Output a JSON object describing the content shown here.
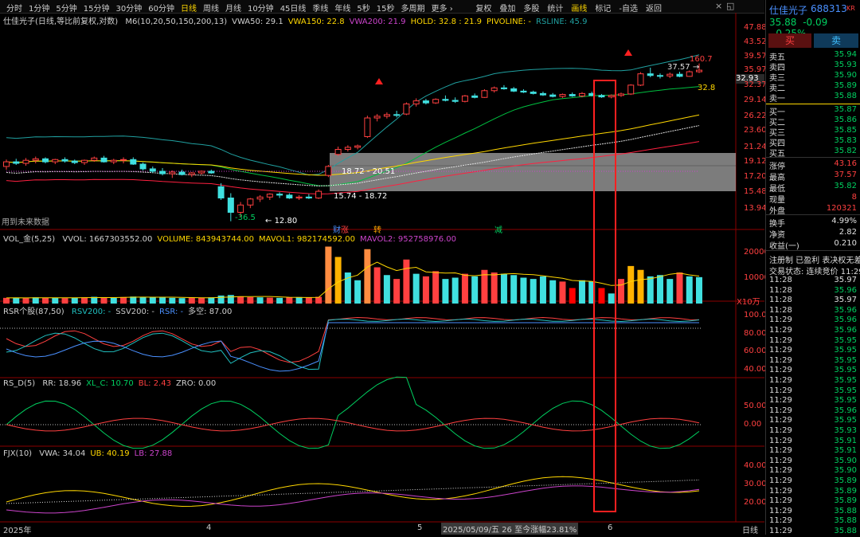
{
  "toolbar": {
    "periods": [
      "分时",
      "1分钟",
      "5分钟",
      "15分钟",
      "30分钟",
      "60分钟",
      "日线",
      "周线",
      "月线",
      "10分钟",
      "45日线",
      "季线",
      "年线",
      "5秒",
      "15秒",
      "多周期",
      "更多 ›"
    ],
    "active_period": "日线",
    "tools": [
      "复权",
      "叠加",
      "多股",
      "统计",
      "画线",
      "标记",
      "-自选",
      "返回"
    ],
    "highlight_tool": "画线",
    "window_controls": [
      "×",
      "◱"
    ]
  },
  "main_panel": {
    "title": "仕佳光子(日线,等比前复权,对数)",
    "indicators": [
      {
        "text": "M6(10,20,50,150,200,13)",
        "color": "#d0d0d0"
      },
      {
        "text": "VWA50: 29.1",
        "color": "#d0d0d0"
      },
      {
        "text": "VWA150: 22.8",
        "color": "#ffd700"
      },
      {
        "text": "VWA200: 21.9",
        "color": "#cc44cc"
      },
      {
        "text": "HOLD: 32.8 : 21.9",
        "color": "#ffd700"
      },
      {
        "text": "PIVOLINE: -",
        "color": "#ffd700"
      },
      {
        "text": "RSLINE: 45.9",
        "color": "#20a0a0"
      }
    ],
    "y_ticks": [
      "47.88",
      "43.52",
      "39.57",
      "35.97",
      "32.37",
      "29.14",
      "26.22",
      "23.60",
      "21.24",
      "19.12",
      "17.20",
      "15.48",
      "13.94"
    ],
    "current_price_tag": "32.93",
    "annotations": {
      "high_label": "160.7",
      "high_price": "37.57",
      "hold_label": "32.8",
      "zone_upper": "18.72 - 20.51",
      "zone_lower": "15.74 - 18.72",
      "low_price": "12.80",
      "low_pct": "-36.5",
      "future_note": "用到未来数据"
    }
  },
  "volume_panel": {
    "title": "VOL_金(5,25)",
    "values": [
      {
        "text": "VVOL: 1667303552.00",
        "color": "#d0d0d0"
      },
      {
        "text": "VOLUME: 843943744.00",
        "color": "#ffd700"
      },
      {
        "text": "MAVOL1: 982174592.00",
        "color": "#ffd700"
      },
      {
        "text": "MAVOL2: 952758976.00",
        "color": "#cc44cc"
      }
    ],
    "y_ticks": [
      "20000",
      "10000"
    ],
    "unit": "X10万",
    "event_tags": [
      {
        "text": "财",
        "color": "#4a90ff"
      },
      {
        "text": "涨",
        "color": "#ff4040"
      },
      {
        "text": "转",
        "color": "#ffa500"
      },
      {
        "text": "减",
        "color": "#00d060"
      }
    ]
  },
  "rsr_panel": {
    "title": "RSR个股(87,50)",
    "values": [
      {
        "text": "RSV200: -",
        "color": "#20c0c0"
      },
      {
        "text": "SSV200: -",
        "color": "#c8c8c8"
      },
      {
        "text": "RSR: -",
        "color": "#4a90ff"
      },
      {
        "text": "多空: 87.00",
        "color": "#d0d0d0"
      }
    ],
    "y_ticks": [
      "100.0",
      "80.00",
      "60.00",
      "40.00"
    ]
  },
  "rsd_panel": {
    "title": "RS_D(5)",
    "values": [
      {
        "text": "RR: 18.96",
        "color": "#d0d0d0"
      },
      {
        "text": "XL_C: 10.70",
        "color": "#00d060"
      },
      {
        "text": "BL: 2.43",
        "color": "#ff4040"
      },
      {
        "text": "ZRO: 0.00",
        "color": "#d0d0d0"
      }
    ],
    "y_ticks": [
      "50.00",
      "0.00"
    ]
  },
  "fjx_panel": {
    "title": "FJX(10)",
    "values": [
      {
        "text": "VWA: 34.04",
        "color": "#d0d0d0"
      },
      {
        "text": "UB: 40.19",
        "color": "#ffd700"
      },
      {
        "text": "LB: 27.88",
        "color": "#cc44cc"
      }
    ],
    "y_ticks": [
      "40.00",
      "30.00",
      "20.00"
    ]
  },
  "time_axis": {
    "labels": [
      "2025年",
      "4",
      "5",
      "6"
    ],
    "status": "2025/05/09/五 26 至今涨幅23.81%",
    "mode": "日线"
  },
  "quote": {
    "name": "仕佳光子",
    "code": "688313",
    "market": "KR",
    "price": "35.88",
    "change": "-0.09",
    "change_pct": "-0.25%",
    "buy_label": "买",
    "sell_label": "卖",
    "asks": [
      {
        "label": "卖五",
        "price": "35.94"
      },
      {
        "label": "卖四",
        "price": "35.93"
      },
      {
        "label": "卖三",
        "price": "35.90"
      },
      {
        "label": "卖二",
        "price": "35.89"
      },
      {
        "label": "卖一",
        "price": "35.88"
      }
    ],
    "bids": [
      {
        "label": "买一",
        "price": "35.87"
      },
      {
        "label": "买二",
        "price": "35.86"
      },
      {
        "label": "买三",
        "price": "35.85"
      },
      {
        "label": "买四",
        "price": "35.83"
      },
      {
        "label": "买五",
        "price": "35.82"
      }
    ],
    "stats": [
      {
        "label": "涨停",
        "value": "43.16",
        "color": "#ff4040"
      },
      {
        "label": "最高",
        "value": "37.57",
        "color": "#ff4040"
      },
      {
        "label": "最低",
        "value": "35.82",
        "color": "#00d060"
      },
      {
        "label": "现量",
        "value": "8",
        "color": "#ff4040"
      },
      {
        "label": "外盘",
        "value": "120321",
        "color": "#ff4040"
      }
    ],
    "stats2": [
      {
        "label": "换手",
        "value": "4.99%"
      },
      {
        "label": "净资",
        "value": "2.82"
      },
      {
        "label": "收益(一)",
        "value": "0.210"
      }
    ],
    "info1": "注册制 已盈利 表决权无差",
    "info2": "交易状态: 连续竞价 11:29",
    "ticks": [
      {
        "time": "11:28",
        "price": "35.97",
        "color": "#e0e0e0"
      },
      {
        "time": "11:28",
        "price": "35.96",
        "color": "#00d060"
      },
      {
        "time": "11:28",
        "price": "35.97",
        "color": "#e0e0e0"
      },
      {
        "time": "11:28",
        "price": "35.96",
        "color": "#00d060"
      },
      {
        "time": "11:29",
        "price": "35.96",
        "color": "#00d060"
      },
      {
        "time": "11:29",
        "price": "35.96",
        "color": "#00d060"
      },
      {
        "time": "11:29",
        "price": "35.95",
        "color": "#00d060"
      },
      {
        "time": "11:29",
        "price": "35.95",
        "color": "#00d060"
      },
      {
        "time": "11:29",
        "price": "35.95",
        "color": "#00d060"
      },
      {
        "time": "11:29",
        "price": "35.95",
        "color": "#00d060"
      },
      {
        "time": "11:29",
        "price": "35.95",
        "color": "#00d060"
      },
      {
        "time": "11:29",
        "price": "35.95",
        "color": "#00d060"
      },
      {
        "time": "11:29",
        "price": "35.95",
        "color": "#00d060"
      },
      {
        "time": "11:29",
        "price": "35.96",
        "color": "#00d060"
      },
      {
        "time": "11:29",
        "price": "35.95",
        "color": "#00d060"
      },
      {
        "time": "11:29",
        "price": "35.93",
        "color": "#00d060"
      },
      {
        "time": "11:29",
        "price": "35.91",
        "color": "#00d060"
      },
      {
        "time": "11:29",
        "price": "35.91",
        "color": "#00d060"
      },
      {
        "time": "11:29",
        "price": "35.90",
        "color": "#00d060"
      },
      {
        "time": "11:29",
        "price": "35.90",
        "color": "#00d060"
      },
      {
        "time": "11:29",
        "price": "35.89",
        "color": "#00d060"
      },
      {
        "time": "11:29",
        "price": "35.89",
        "color": "#00d060"
      },
      {
        "time": "11:29",
        "price": "35.89",
        "color": "#00d060"
      },
      {
        "time": "11:29",
        "price": "35.88",
        "color": "#00d060"
      },
      {
        "time": "11:29",
        "price": "35.88",
        "color": "#00d060"
      },
      {
        "time": "11:29",
        "price": "35.88",
        "color": "#00d060"
      }
    ]
  },
  "colors": {
    "up": "#ff4040",
    "down": "#40e0e0",
    "volume_up": "#ff4040",
    "volume_down": "#40e0e0",
    "highlight_box": "#ff2020"
  },
  "chart_data": {
    "type": "candlestick",
    "scale": "log",
    "ylim": [
      13.94,
      47.88
    ],
    "candles": [
      [
        18.6,
        19.5,
        18.2,
        19.2
      ],
      [
        19.2,
        19.6,
        18.8,
        19.0
      ],
      [
        19.0,
        19.7,
        18.7,
        19.4
      ],
      [
        19.4,
        19.9,
        19.0,
        19.6
      ],
      [
        19.6,
        19.8,
        19.0,
        19.2
      ],
      [
        19.2,
        19.6,
        18.9,
        19.5
      ],
      [
        19.5,
        19.8,
        19.1,
        19.3
      ],
      [
        19.3,
        19.5,
        18.9,
        19.1
      ],
      [
        19.1,
        19.5,
        18.8,
        19.4
      ],
      [
        19.4,
        19.9,
        19.2,
        19.7
      ],
      [
        19.7,
        20.0,
        19.1,
        19.2
      ],
      [
        19.2,
        19.6,
        18.9,
        19.4
      ],
      [
        19.4,
        19.8,
        19.0,
        19.5
      ],
      [
        19.5,
        19.8,
        18.8,
        18.9
      ],
      [
        18.9,
        19.1,
        18.1,
        18.3
      ],
      [
        18.3,
        18.6,
        17.8,
        18.0
      ],
      [
        18.0,
        18.4,
        17.5,
        17.7
      ],
      [
        17.7,
        18.1,
        17.2,
        17.9
      ],
      [
        17.9,
        18.2,
        17.5,
        17.6
      ],
      [
        17.6,
        17.9,
        17.3,
        17.8
      ],
      [
        17.8,
        18.1,
        17.6,
        18.0
      ],
      [
        18.0,
        18.2,
        17.7,
        17.8
      ],
      [
        16.2,
        16.6,
        14.8,
        15.0
      ],
      [
        15.0,
        15.5,
        12.8,
        13.6
      ],
      [
        13.6,
        14.6,
        13.2,
        14.3
      ],
      [
        14.3,
        15.0,
        14.0,
        14.9
      ],
      [
        14.9,
        15.3,
        14.6,
        15.1
      ],
      [
        15.1,
        15.5,
        14.8,
        15.4
      ],
      [
        15.4,
        15.6,
        15.0,
        15.3
      ],
      [
        15.3,
        15.5,
        14.9,
        15.0
      ],
      [
        15.0,
        15.3,
        14.8,
        15.1
      ],
      [
        15.1,
        15.4,
        14.9,
        15.0
      ],
      [
        15.0,
        15.9,
        14.9,
        15.7
      ],
      [
        17.5,
        18.8,
        17.3,
        18.6
      ],
      [
        20.2,
        21.3,
        20.0,
        20.9
      ],
      [
        20.9,
        21.5,
        20.6,
        21.2
      ],
      [
        21.2,
        21.6,
        20.9,
        21.4
      ],
      [
        22.8,
        26.3,
        22.6,
        25.9
      ],
      [
        25.9,
        26.6,
        25.3,
        26.2
      ],
      [
        26.2,
        26.9,
        25.8,
        26.5
      ],
      [
        26.5,
        27.2,
        26.0,
        26.4
      ],
      [
        26.6,
        28.8,
        26.4,
        28.5
      ],
      [
        28.5,
        29.6,
        28.0,
        29.1
      ],
      [
        29.1,
        29.5,
        28.4,
        28.7
      ],
      [
        28.7,
        29.6,
        28.5,
        29.4
      ],
      [
        29.4,
        30.2,
        29.0,
        29.2
      ],
      [
        29.2,
        29.8,
        28.7,
        29.0
      ],
      [
        29.0,
        30.3,
        28.8,
        30.1
      ],
      [
        30.1,
        30.6,
        29.6,
        29.8
      ],
      [
        29.8,
        31.5,
        29.7,
        31.2
      ],
      [
        31.2,
        32.1,
        30.8,
        31.8
      ],
      [
        31.8,
        32.4,
        31.4,
        31.6
      ],
      [
        31.6,
        32.0,
        30.9,
        31.1
      ],
      [
        31.1,
        31.5,
        30.7,
        30.9
      ],
      [
        30.9,
        31.2,
        30.4,
        30.6
      ],
      [
        30.6,
        31.0,
        30.1,
        30.3
      ],
      [
        30.3,
        30.7,
        29.8,
        30.0
      ],
      [
        30.0,
        30.6,
        29.7,
        30.4
      ],
      [
        30.4,
        30.8,
        29.9,
        30.1
      ],
      [
        30.1,
        30.9,
        29.8,
        30.6
      ],
      [
        30.6,
        31.0,
        30.0,
        30.2
      ],
      [
        30.2,
        30.5,
        29.7,
        29.9
      ],
      [
        29.9,
        30.4,
        29.6,
        30.2
      ],
      [
        30.2,
        30.8,
        29.9,
        30.5
      ],
      [
        30.5,
        32.6,
        30.3,
        32.4
      ],
      [
        32.4,
        35.4,
        32.2,
        35.0
      ],
      [
        35.0,
        36.5,
        34.2,
        34.6
      ],
      [
        34.6,
        35.1,
        33.9,
        34.5
      ],
      [
        34.5,
        35.3,
        34.0,
        34.9
      ],
      [
        34.9,
        35.5,
        34.2,
        34.4
      ],
      [
        34.4,
        35.8,
        34.3,
        35.5
      ],
      [
        35.5,
        37.57,
        35.2,
        35.88
      ]
    ],
    "volumes": [
      [
        2200,
        0
      ],
      [
        2300,
        1
      ],
      [
        2100,
        0
      ],
      [
        2400,
        1
      ],
      [
        2200,
        0
      ],
      [
        2300,
        1
      ],
      [
        2100,
        0
      ],
      [
        2200,
        1
      ],
      [
        2400,
        0
      ],
      [
        2600,
        1
      ],
      [
        2300,
        0
      ],
      [
        2200,
        1
      ],
      [
        2500,
        0
      ],
      [
        2700,
        1
      ],
      [
        2600,
        1
      ],
      [
        2400,
        1
      ],
      [
        2300,
        1
      ],
      [
        2200,
        1
      ],
      [
        2100,
        1
      ],
      [
        2300,
        0
      ],
      [
        2200,
        0
      ],
      [
        2400,
        1
      ],
      [
        3100,
        1
      ],
      [
        3300,
        1
      ],
      [
        2800,
        0
      ],
      [
        2500,
        0
      ],
      [
        2400,
        1
      ],
      [
        2300,
        0
      ],
      [
        2200,
        1
      ],
      [
        2400,
        0
      ],
      [
        2500,
        1
      ],
      [
        2300,
        0
      ],
      [
        2600,
        0
      ],
      [
        22000,
        2
      ],
      [
        18000,
        3
      ],
      [
        12000,
        1
      ],
      [
        9000,
        1
      ],
      [
        21000,
        2
      ],
      [
        14000,
        0
      ],
      [
        11000,
        1
      ],
      [
        9500,
        0
      ],
      [
        17000,
        0
      ],
      [
        11500,
        1
      ],
      [
        10500,
        0
      ],
      [
        12500,
        0
      ],
      [
        9500,
        1
      ],
      [
        10000,
        1
      ],
      [
        11500,
        0
      ],
      [
        10500,
        1
      ],
      [
        13000,
        0
      ],
      [
        12000,
        0
      ],
      [
        11500,
        1
      ],
      [
        11000,
        1
      ],
      [
        10000,
        1
      ],
      [
        9500,
        1
      ],
      [
        10500,
        1
      ],
      [
        9000,
        1
      ],
      [
        8500,
        0
      ],
      [
        6000,
        4
      ],
      [
        9000,
        1
      ],
      [
        8500,
        1
      ],
      [
        6000,
        4
      ],
      [
        3900,
        1
      ],
      [
        9500,
        0
      ],
      [
        14500,
        3
      ],
      [
        13000,
        3
      ],
      [
        10500,
        1
      ],
      [
        11000,
        1
      ],
      [
        9500,
        1
      ],
      [
        12000,
        0
      ],
      [
        10500,
        1
      ],
      [
        10200,
        1
      ]
    ],
    "volume_colors": [
      "#ff4040",
      "#40e0e0",
      "#ff8c40",
      "#ffb300",
      "#ff0000"
    ]
  }
}
